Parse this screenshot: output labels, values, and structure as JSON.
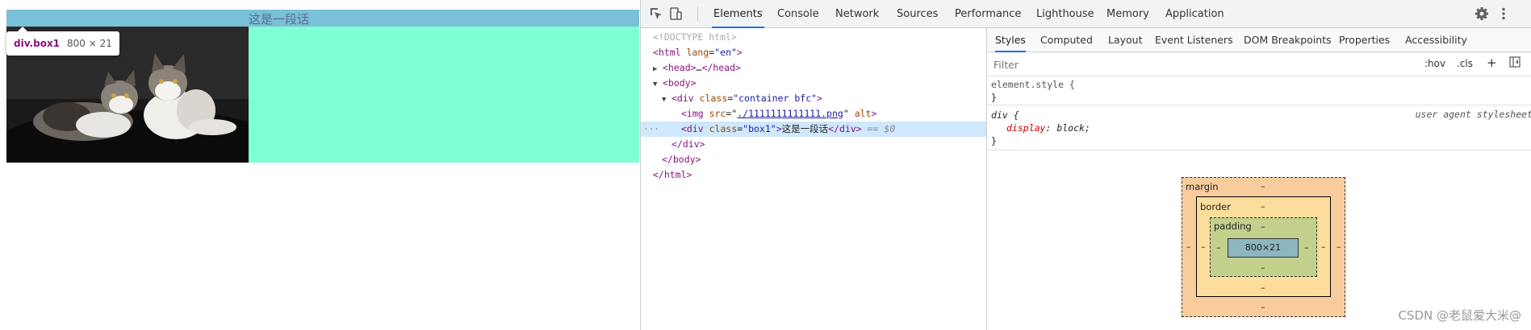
{
  "preview": {
    "box1_text": "这是一段话",
    "tooltip_selector": "div.box1",
    "tooltip_size": "800 × 21",
    "colors": {
      "container_bg": "#7fffd4",
      "box1_highlight": "#79c1d6"
    }
  },
  "devtools": {
    "main_tabs": [
      {
        "label": "Elements",
        "active": true
      },
      {
        "label": "Console"
      },
      {
        "label": "Network"
      },
      {
        "label": "Sources"
      },
      {
        "label": "Performance"
      },
      {
        "label": "Lighthouse"
      },
      {
        "label": "Memory"
      },
      {
        "label": "Application"
      }
    ],
    "icons": [
      "inspect-element-icon",
      "device-toolbar-icon",
      "settings-gear-icon",
      "more-options-icon"
    ],
    "dom": {
      "doctype": "<!DOCTYPE html>",
      "html_tag": "html",
      "lang_attr": "lang",
      "lang_val": "\"en\"",
      "head_collapsed": "…",
      "body_tag": "body",
      "container_class": "\"container bfc\"",
      "img_src": "./1111111111111.png",
      "img_alt": "alt",
      "box1_class": "\"box1\"",
      "box1_text": "这是一段话",
      "eq0": "== $0"
    },
    "styles": {
      "sub_tabs": [
        {
          "label": "Styles",
          "active": true
        },
        {
          "label": "Computed"
        },
        {
          "label": "Layout"
        },
        {
          "label": "Event Listeners"
        },
        {
          "label": "DOM Breakpoints"
        },
        {
          "label": "Properties"
        },
        {
          "label": "Accessibility"
        }
      ],
      "filter_placeholder": "Filter",
      "hov_label": ":hov",
      "cls_label": ".cls",
      "element_style_selector": "element.style {",
      "rule_selector": "div {",
      "rule_source": "user agent stylesheet",
      "rule_prop": "display",
      "rule_value": "block;",
      "closing_brace": "}"
    },
    "box_model": {
      "margin_label": "margin",
      "border_label": "border",
      "padding_label": "padding",
      "content_size": "800×21",
      "dash": "–"
    }
  },
  "watermark": "CSDN @老鼠爱大米@"
}
